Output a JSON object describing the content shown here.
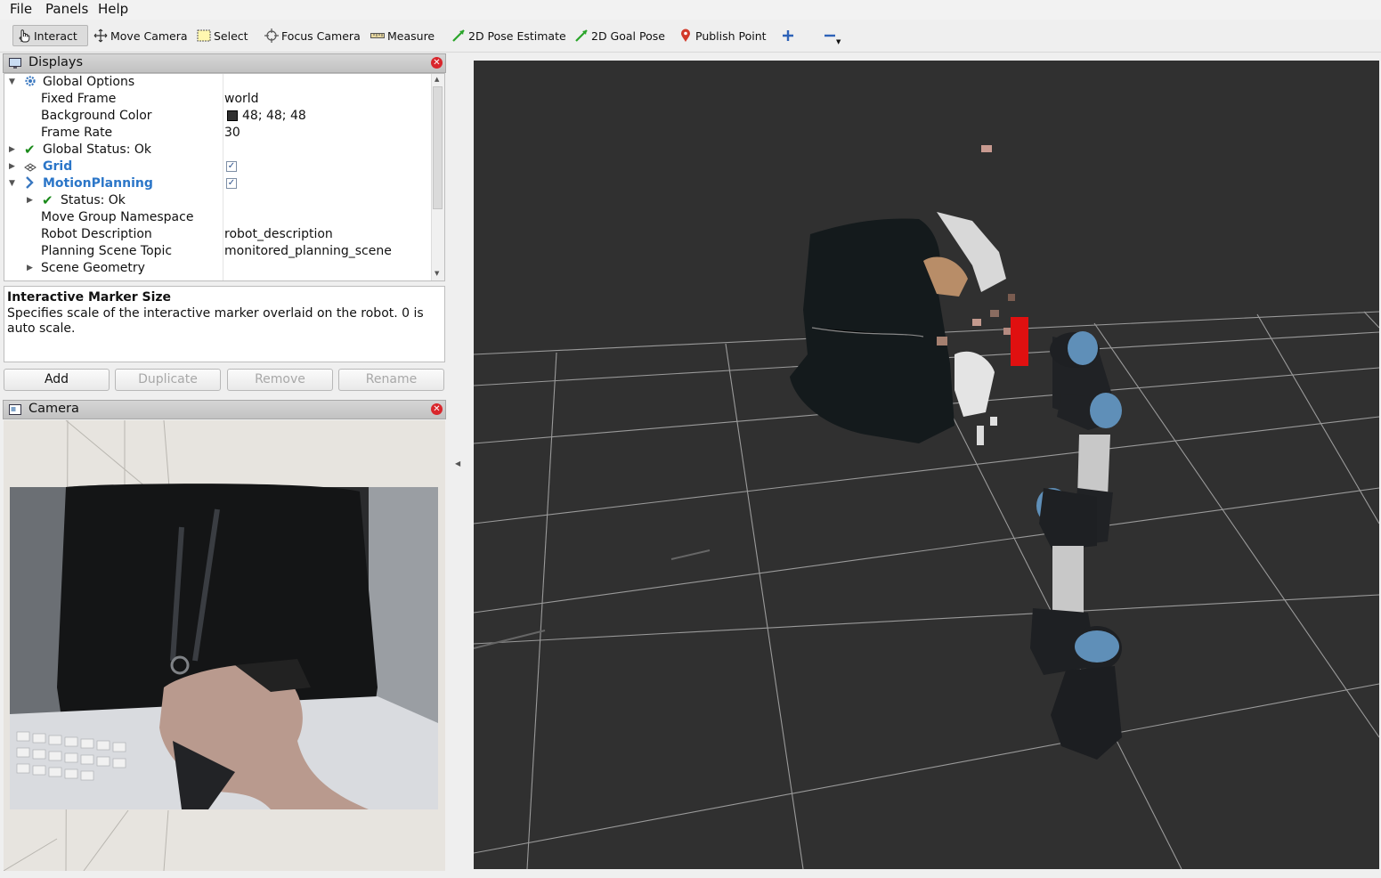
{
  "menu": {
    "file": "File",
    "panels": "Panels",
    "help": "Help"
  },
  "toolbar": {
    "interact": "Interact",
    "move_camera": "Move Camera",
    "select": "Select",
    "focus_camera": "Focus Camera",
    "measure": "Measure",
    "pose_estimate": "2D Pose Estimate",
    "goal_pose": "2D Goal Pose",
    "publish_point": "Publish Point"
  },
  "displays": {
    "title": "Displays",
    "rows": [
      {
        "name": "Global Options",
        "value": ""
      },
      {
        "name": "Fixed Frame",
        "value": "world"
      },
      {
        "name": "Background Color",
        "value": "48; 48; 48"
      },
      {
        "name": "Frame Rate",
        "value": "30"
      },
      {
        "name": "Global Status: Ok",
        "value": ""
      },
      {
        "name": "Grid",
        "value": ""
      },
      {
        "name": "MotionPlanning",
        "value": ""
      },
      {
        "name": "Status: Ok",
        "value": ""
      },
      {
        "name": "Move Group Namespace",
        "value": ""
      },
      {
        "name": "Robot Description",
        "value": "robot_description"
      },
      {
        "name": "Planning Scene Topic",
        "value": "monitored_planning_scene"
      },
      {
        "name": "Scene Geometry",
        "value": ""
      }
    ],
    "grid_checked": true,
    "motionplanning_checked": true
  },
  "description": {
    "title": "Interactive Marker Size",
    "text": "Specifies scale of the interactive marker overlaid on the robot. 0 is auto scale."
  },
  "buttons": {
    "add": "Add",
    "duplicate": "Duplicate",
    "remove": "Remove",
    "rename": "Rename"
  },
  "camera": {
    "title": "Camera"
  },
  "colors": {
    "viewport_bg": "#303030",
    "accent_blue": "#2b76c8",
    "status_green": "#1a8a1a",
    "close_red": "#d9262c"
  }
}
